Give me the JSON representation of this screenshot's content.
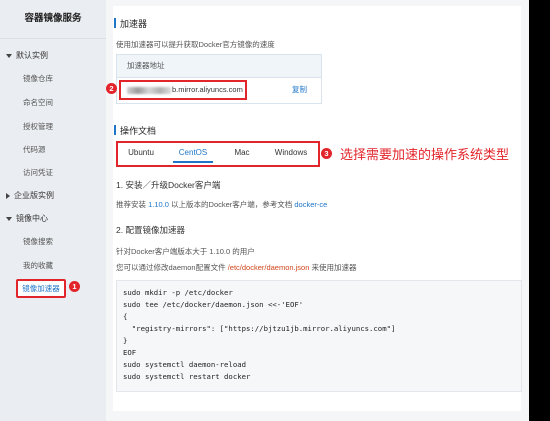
{
  "sidebar": {
    "title": "容器镜像服务",
    "groups": [
      {
        "label": "默认实例",
        "expanded": true
      },
      {
        "label": "企业版实例",
        "expanded": false
      },
      {
        "label": "镜像中心",
        "expanded": true
      }
    ],
    "items": [
      "镜像仓库",
      "命名空间",
      "授权管理",
      "代码源",
      "访问凭证"
    ],
    "center_items": [
      "镜像搜索",
      "我的收藏"
    ],
    "active_item": "镜像加速器"
  },
  "accelerator": {
    "heading": "加速器",
    "description": "使用加速器可以提升获取Docker官方镜像的速度",
    "table_header": "加速器地址",
    "address_suffix": "b.mirror.aliyuncs.com",
    "copy_label": "复制"
  },
  "docs": {
    "heading": "操作文档",
    "tabs": [
      "Ubuntu",
      "CentOS",
      "Mac",
      "Windows"
    ],
    "active_tab": "CentOS",
    "annotation": "选择需要加速的操作系统类型",
    "step1_title": "1. 安装／升级Docker客户端",
    "step1_prefix": "推荐安装 ",
    "step1_version": "1.10.0",
    "step1_middle": " 以上版本的Docker客户端，参考文档 ",
    "step1_link": "docker-ce",
    "step2_title": "2. 配置镜像加速器",
    "step2_line1": "针对Docker客户端版本大于 1.10.0 的用户",
    "step2_line2_prefix": "您可以通过修改daemon配置文件 ",
    "step2_line2_path": "/etc/docker/daemon.json",
    "step2_line2_suffix": " 来使用加速器",
    "code_lines": [
      "sudo mkdir -p /etc/docker",
      "sudo tee /etc/docker/daemon.json <<-'EOF'",
      "{",
      "  \"registry-mirrors\": [\"https://bjtzu1jb.mirror.aliyuncs.com\"]",
      "}",
      "EOF",
      "sudo systemctl daemon-reload",
      "sudo systemctl restart docker"
    ]
  },
  "badges": [
    "1",
    "2",
    "3"
  ],
  "colors": {
    "accent": "#1f76c9",
    "annotation": "#e2252b",
    "path": "#d0451b"
  }
}
